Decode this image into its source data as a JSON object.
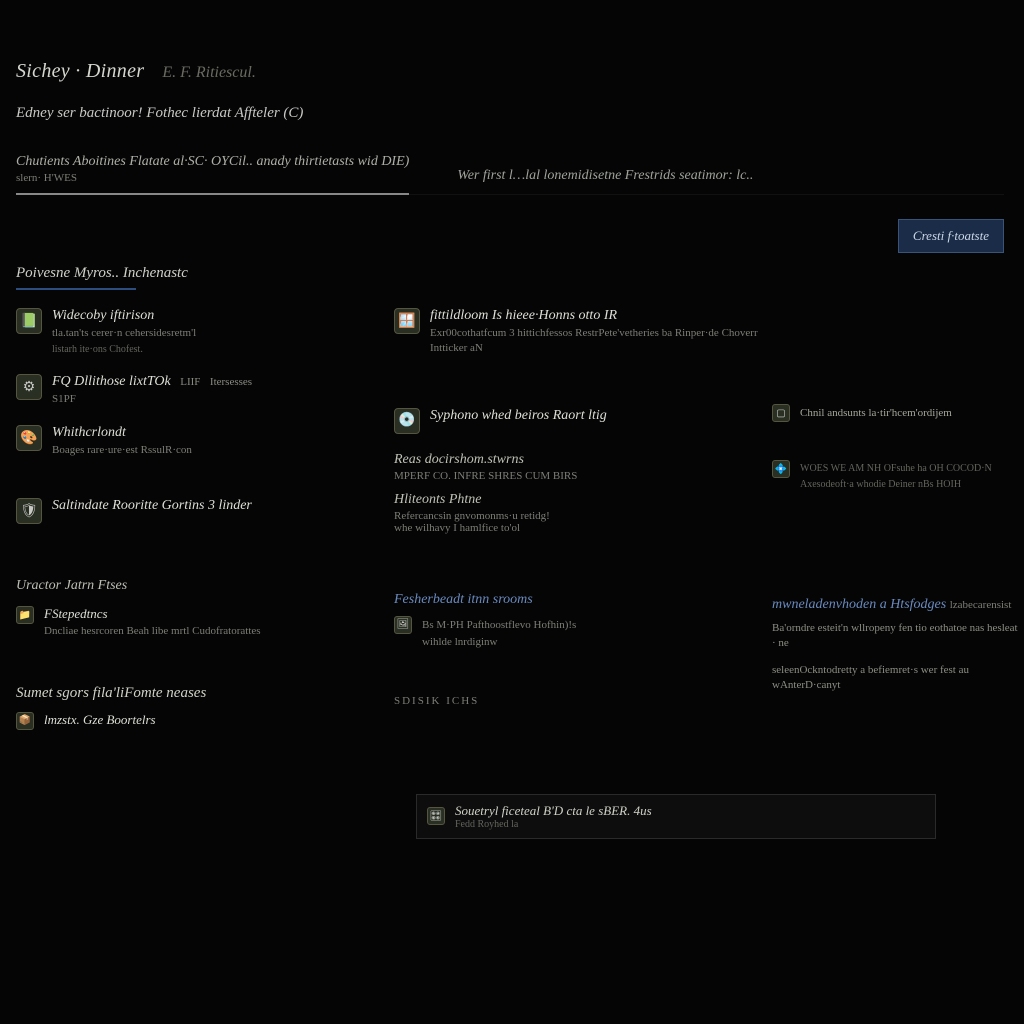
{
  "header": {
    "title": "Sichey · Dinner",
    "version": "E. F. Ritiescul.",
    "subtitle": "Edney ser bactinoor! Fothec lierdat Affteler (C)"
  },
  "tabs": {
    "primary": {
      "line1": "Chutients Aboitines Flatate al·SC· OYCil.. anady thirtietasts wid DIE)",
      "line2": "slern· H'WES"
    },
    "secondary": "Wer first l…lal lonemidisetne Frestrids seatimor: lc.."
  },
  "action_button": "Cresti f·toatste",
  "section": {
    "title": "Poivesne Myros.. Inchenastc"
  },
  "col1": {
    "item1": {
      "title": "Widecoby iftirison",
      "sub1": "tla.tan'ts cerer·n cehersidesretm'l",
      "sub2": "listarh ite·ons Chofest."
    },
    "item2": {
      "title": "FQ Dllithose lixtTOk",
      "badge": "LIIF",
      "tag": "Itersesses",
      "sub": "S1PF"
    },
    "item3": {
      "title": "Whithcrlondt",
      "sub": "Boages rare·ure·est RssulR·con"
    },
    "item4": {
      "title": "Saltindate Rooritte Gortins 3 linder"
    },
    "heading_lower": "Uractor Jatrn Ftses",
    "item5": {
      "title": "FStepedtncs",
      "sub": "Dncliae hesrcoren Beah libe mrtl Cudofratorattes"
    },
    "heading_lower2": "Sumet sgors fila'liFomte neases",
    "item6": {
      "title": "lmzstx. Gze Boortelrs"
    }
  },
  "col2": {
    "item1": {
      "title": "fittildloom Is hieee·Honns otto IR",
      "sub": "Exr00cothatfcum 3 hittichfessos RestrPete'vetheries ba Rinper·de Choverr Intticker aN"
    },
    "item2": {
      "title": "Syphono whed beiros Raort ltig"
    },
    "heading1": "Reas docirshom.stwrns",
    "heading1_sub": "MPERF CO. INFRE SHRES CUM BIRS",
    "heading2": "Hliteonts Phtne",
    "heading2_sub1": "Refercancsin gnvomonms·u retidg!",
    "heading2_sub2": "whe wilhavy I hamlfice to'ol",
    "heading3": "Fesherbeadt itnn srooms",
    "item3": {
      "sub1": "Bs M·PH Pafthoostflevo Hofhin)!s",
      "sub2": "wihlde lnrdiginw"
    },
    "heading4": "SDISIK ICHS"
  },
  "col3": {
    "item1": {
      "title": "Chnil andsunts la·tir'hcem'ordijem"
    },
    "item2": {
      "sub1": "WOES WE AM NH OFsuhe ha OH COCOD·N",
      "sub2": "Axesodeoft·a whodie Deiner nBs HOIH"
    },
    "link": "mwneladenvhoden a Htsfodges",
    "link_tail": "lzabecarensist",
    "para1": "Ba'orndre esteit'n wllropeny fen tio eothatoe nas hesleat · ne",
    "para2": "seleenOckntodretty a befiemret·s wer fest au wAnterD·canyt"
  },
  "footer_card": {
    "title": "Souetryl ficeteal B'D cta le sBER. 4us",
    "sub": "Fedd Royhed la"
  },
  "icons": {
    "book": "📗",
    "gear": "⚙",
    "disc": "💿",
    "cube": "🎛",
    "palette": "🎨",
    "shield": "🛡",
    "folder": "📁",
    "window": "🪟",
    "image": "🖼",
    "chip": "💠",
    "box": "📦",
    "square": "▢"
  }
}
